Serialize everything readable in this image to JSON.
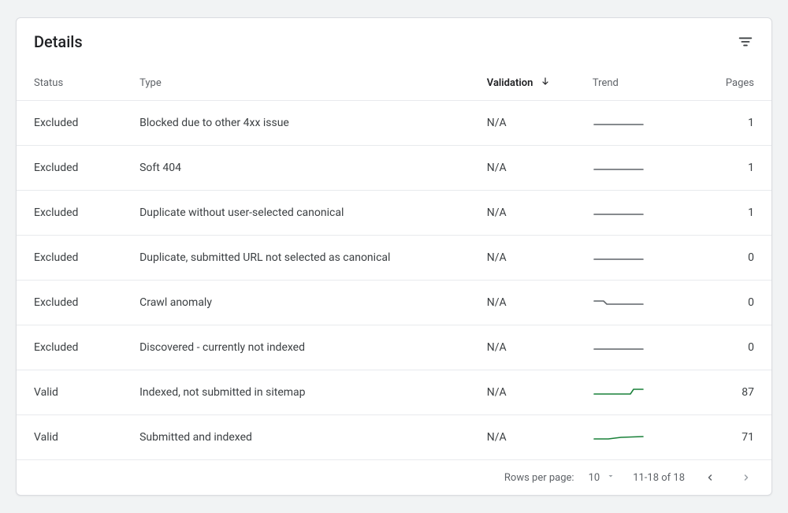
{
  "header": {
    "title": "Details"
  },
  "table": {
    "columns": {
      "status": "Status",
      "type": "Type",
      "validation": "Validation",
      "trend": "Trend",
      "pages": "Pages"
    },
    "rows": [
      {
        "status": "Excluded",
        "statusKind": "excluded",
        "type": "Blocked due to other 4xx issue",
        "validation": "N/A",
        "trend": "flat-gray",
        "pages": "1"
      },
      {
        "status": "Excluded",
        "statusKind": "excluded",
        "type": "Soft 404",
        "validation": "N/A",
        "trend": "flat-gray",
        "pages": "1"
      },
      {
        "status": "Excluded",
        "statusKind": "excluded",
        "type": "Duplicate without user-selected canonical",
        "validation": "N/A",
        "trend": "flat-gray",
        "pages": "1"
      },
      {
        "status": "Excluded",
        "statusKind": "excluded",
        "type": "Duplicate, submitted URL not selected as canonical",
        "validation": "N/A",
        "trend": "flat-gray",
        "pages": "0"
      },
      {
        "status": "Excluded",
        "statusKind": "excluded",
        "type": "Crawl anomaly",
        "validation": "N/A",
        "trend": "dip-gray",
        "pages": "0"
      },
      {
        "status": "Excluded",
        "statusKind": "excluded",
        "type": "Discovered - currently not indexed",
        "validation": "N/A",
        "trend": "flat-gray",
        "pages": "0"
      },
      {
        "status": "Valid",
        "statusKind": "valid",
        "type": "Indexed, not submitted in sitemap",
        "validation": "N/A",
        "trend": "step-up-green",
        "pages": "87"
      },
      {
        "status": "Valid",
        "statusKind": "valid",
        "type": "Submitted and indexed",
        "validation": "N/A",
        "trend": "rise-green",
        "pages": "71"
      }
    ]
  },
  "footer": {
    "rows_per_page_label": "Rows per page:",
    "rows_per_page_value": "10",
    "range_text": "11-18 of 18"
  }
}
